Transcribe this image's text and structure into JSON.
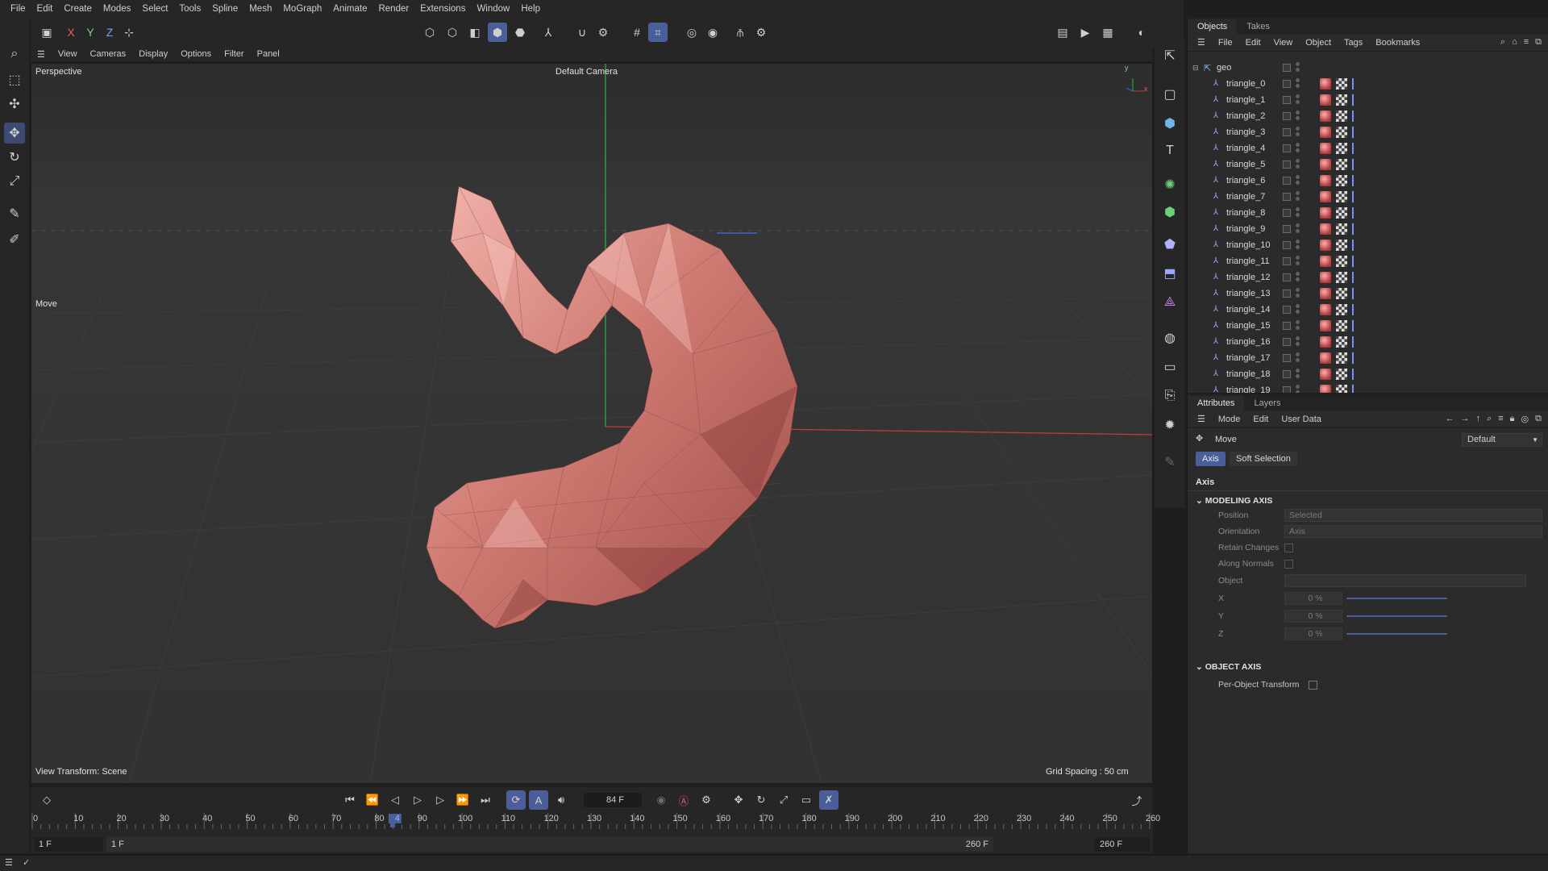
{
  "menubar": {
    "items": [
      "File",
      "Edit",
      "Create",
      "Modes",
      "Select",
      "Tools",
      "Spline",
      "Mesh",
      "MoGraph",
      "Animate",
      "Render",
      "Extensions",
      "Window",
      "Help"
    ]
  },
  "toolbar": {
    "axis_x": "X",
    "axis_y": "Y",
    "axis_z": "Z"
  },
  "viewport": {
    "menu": [
      "View",
      "Cameras",
      "Display",
      "Options",
      "Filter",
      "Panel"
    ],
    "view_name": "Perspective",
    "camera": "Default Camera",
    "tool_label": "Move",
    "view_transform": "View Transform: Scene",
    "grid_spacing": "Grid Spacing : 50 cm",
    "axis_y": "y",
    "axis_x": "x"
  },
  "objects_panel": {
    "tabs": [
      "Objects",
      "Takes"
    ],
    "menu": [
      "File",
      "Edit",
      "View",
      "Object",
      "Tags",
      "Bookmarks"
    ],
    "root": "geo",
    "items": [
      "triangle_0",
      "triangle_1",
      "triangle_2",
      "triangle_3",
      "triangle_4",
      "triangle_5",
      "triangle_6",
      "triangle_7",
      "triangle_8",
      "triangle_9",
      "triangle_10",
      "triangle_11",
      "triangle_12",
      "triangle_13",
      "triangle_14",
      "triangle_15",
      "triangle_16",
      "triangle_17",
      "triangle_18",
      "triangle_19"
    ]
  },
  "attributes_panel": {
    "tabs": [
      "Attributes",
      "Layers"
    ],
    "menu": [
      "Mode",
      "Edit",
      "User Data"
    ],
    "tool_name": "Move",
    "preset": "Default",
    "subtabs": [
      "Axis",
      "Soft Selection"
    ],
    "section_title": "Axis",
    "modeling_axis": {
      "title": "MODELING AXIS",
      "position_label": "Position",
      "position_value": "Selected",
      "orientation_label": "Orientation",
      "orientation_value": "Axis",
      "retain_label": "Retain Changes",
      "normals_label": "Along Normals",
      "object_label": "Object",
      "x_label": "X",
      "x_value": "0 %",
      "y_label": "Y",
      "y_value": "0 %",
      "z_label": "Z",
      "z_value": "0 %"
    },
    "object_axis": {
      "title": "OBJECT AXIS",
      "per_object_label": "Per-Object Transform"
    }
  },
  "timeline": {
    "current_frame": "84 F",
    "ruler_labels": [
      "0",
      "10",
      "20",
      "30",
      "40",
      "50",
      "60",
      "70",
      "80",
      "84",
      "90",
      "100",
      "110",
      "120",
      "130",
      "140",
      "150",
      "160",
      "170",
      "180",
      "190",
      "200",
      "210",
      "220",
      "230",
      "240",
      "250",
      "260"
    ],
    "start_field": "1 F",
    "start_field2": "1 F",
    "end_field": "260 F",
    "end_field2": "260 F",
    "playhead": 84
  },
  "colors": {
    "accent": "#4a5e9a",
    "mesh": "#c8716c",
    "x_axis": "#c83a3a",
    "y_axis": "#38b058"
  }
}
